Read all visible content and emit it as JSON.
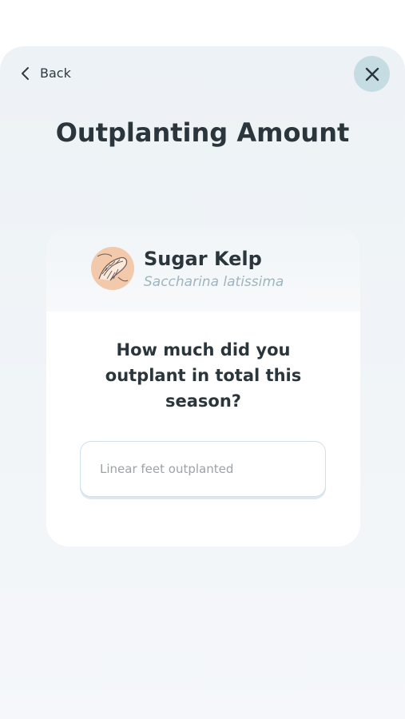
{
  "header": {
    "back_label": "Back",
    "back_icon": "chevron-left-icon",
    "close_icon": "close-icon",
    "title": "Outplanting Amount"
  },
  "species": {
    "common_name": "Sugar Kelp",
    "latin_name": "Saccharina latissima",
    "avatar_icon": "kelp-illustration"
  },
  "question": "How much did you outplant in total this season?",
  "amount_field": {
    "value": "",
    "placeholder": "Linear feet outplanted"
  },
  "colors": {
    "close_button_bg": "#c5dce3",
    "avatar_bg": "#f2c9aa",
    "latin_name_text": "#9fb4be",
    "title_text": "#2b363c"
  }
}
